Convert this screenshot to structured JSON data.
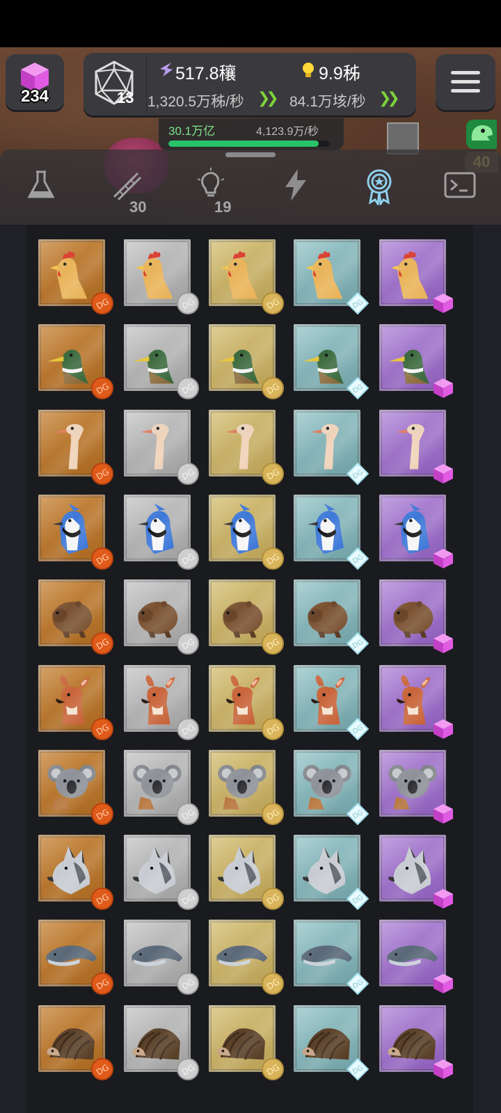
{
  "hud": {
    "gems": "234",
    "dice_level": "13",
    "resource1_value": "517.8穰",
    "resource1_rate": "1,320.5万秭/秒",
    "resource2_value": "9.9秭",
    "resource2_rate": "84.1万垓/秒",
    "progress_label": "30.1万亿",
    "progress_rate": "4,123.9万/秒",
    "progress_fraction": 0.93,
    "side_badge_number": "40"
  },
  "tabs": [
    {
      "name": "science",
      "icon": "flask-icon",
      "count": ""
    },
    {
      "name": "dna",
      "icon": "dna-icon",
      "count": "30"
    },
    {
      "name": "ideas",
      "icon": "lightbulb-icon",
      "count": "19"
    },
    {
      "name": "boost",
      "icon": "lightning-icon",
      "count": ""
    },
    {
      "name": "achievements",
      "icon": "award-icon",
      "count": "",
      "active": true
    },
    {
      "name": "console",
      "icon": "terminal-icon",
      "count": ""
    }
  ],
  "tiers": [
    "bronze",
    "silver",
    "gold",
    "diamond",
    "purple-gem"
  ],
  "animals": [
    "chicken",
    "duck",
    "ostrich",
    "blue-jay",
    "beaver",
    "deer",
    "koala",
    "wolf",
    "whale",
    "hedgehog"
  ],
  "colors": {
    "accent_green": "#27c26a",
    "gem_pink": "#d44fd8",
    "chevron_green": "#7ed33a",
    "active_tab": "#8fd0ee"
  }
}
